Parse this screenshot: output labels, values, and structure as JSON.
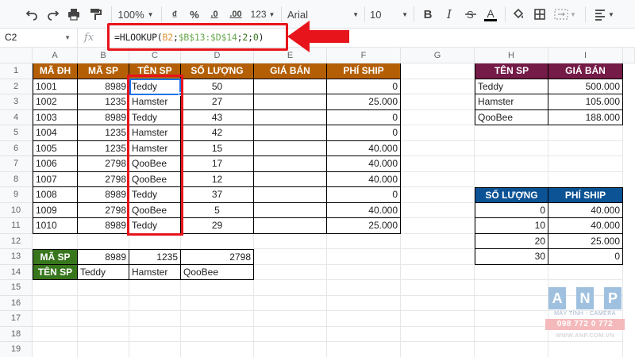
{
  "toolbar": {
    "zoom": "100%",
    "currency_symbol": "₫",
    "percent_symbol": "%",
    "decrease_decimal": ".0",
    "increase_decimal": ".00",
    "more_formats": "123",
    "font_name": "Arial",
    "font_size": "10",
    "bold": "B",
    "text_color": "A"
  },
  "formula_bar": {
    "name_box": "C2",
    "fx_label": "fx",
    "formula_prefix": "=HLOOKUP(",
    "formula_arg1": "B2",
    "formula_sep1": ";",
    "formula_arg2": "$B$13:$D$14",
    "formula_sep2": ";",
    "formula_arg3": "2",
    "formula_sep3": ";",
    "formula_arg4": "0",
    "formula_suffix": ")"
  },
  "columns": [
    "A",
    "B",
    "C",
    "D",
    "E",
    "F",
    "G",
    "H",
    "I"
  ],
  "rows": [
    "1",
    "2",
    "3",
    "4",
    "5",
    "6",
    "7",
    "8",
    "9",
    "10",
    "11",
    "12",
    "13",
    "14",
    "15",
    "16",
    "17",
    "18",
    "19"
  ],
  "main_table": {
    "headers": [
      "MÃ ĐH",
      "MÃ SP",
      "TÊN SP",
      "SỐ LƯỢNG",
      "GIÁ BÁN",
      "PHÍ SHIP"
    ],
    "rows": [
      [
        "1001",
        "8989",
        "Teddy",
        "50",
        "",
        "0"
      ],
      [
        "1002",
        "1235",
        "Hamster",
        "27",
        "",
        "25.000"
      ],
      [
        "1003",
        "8989",
        "Teddy",
        "43",
        "",
        "0"
      ],
      [
        "1004",
        "1235",
        "Hamster",
        "42",
        "",
        "0"
      ],
      [
        "1005",
        "1235",
        "Hamster",
        "15",
        "",
        "40.000"
      ],
      [
        "1006",
        "2798",
        "QooBee",
        "17",
        "",
        "40.000"
      ],
      [
        "1007",
        "2798",
        "QooBee",
        "12",
        "",
        "40.000"
      ],
      [
        "1008",
        "8989",
        "Teddy",
        "37",
        "",
        "0"
      ],
      [
        "1009",
        "2798",
        "QooBee",
        "5",
        "",
        "40.000"
      ],
      [
        "1010",
        "8989",
        "Teddy",
        "29",
        "",
        "25.000"
      ]
    ]
  },
  "lookup_table": {
    "row1_label": "MÃ SP",
    "row1_values": [
      "8989",
      "1235",
      "2798"
    ],
    "row2_label": "TÊN SP",
    "row2_values": [
      "Teddy",
      "Hamster",
      "QooBee"
    ]
  },
  "price_table": {
    "headers": [
      "TÊN SP",
      "GIÁ BÁN"
    ],
    "rows": [
      [
        "Teddy",
        "500.000"
      ],
      [
        "Hamster",
        "105.000"
      ],
      [
        "QooBee",
        "188.000"
      ]
    ]
  },
  "ship_table": {
    "headers": [
      "SỐ LƯỢNG",
      "PHÍ SHIP"
    ],
    "rows": [
      [
        "0",
        "40.000"
      ],
      [
        "10",
        "40.000"
      ],
      [
        "20",
        "25.000"
      ],
      [
        "30",
        "0"
      ]
    ]
  },
  "watermark": {
    "letters": [
      "A",
      "N",
      "P"
    ],
    "subtitle": "MÁY TÍNH - CAMERA",
    "phone": "098 772 0 772",
    "url": "WWW.ANP.COM.VN"
  },
  "colors": {
    "orange_header": "#b45f06",
    "maroon_header": "#741b47",
    "blue_header": "#0b5394",
    "green_header": "#38761d",
    "annotation_red": "#e8141b",
    "selection_blue": "#1a73e8"
  }
}
